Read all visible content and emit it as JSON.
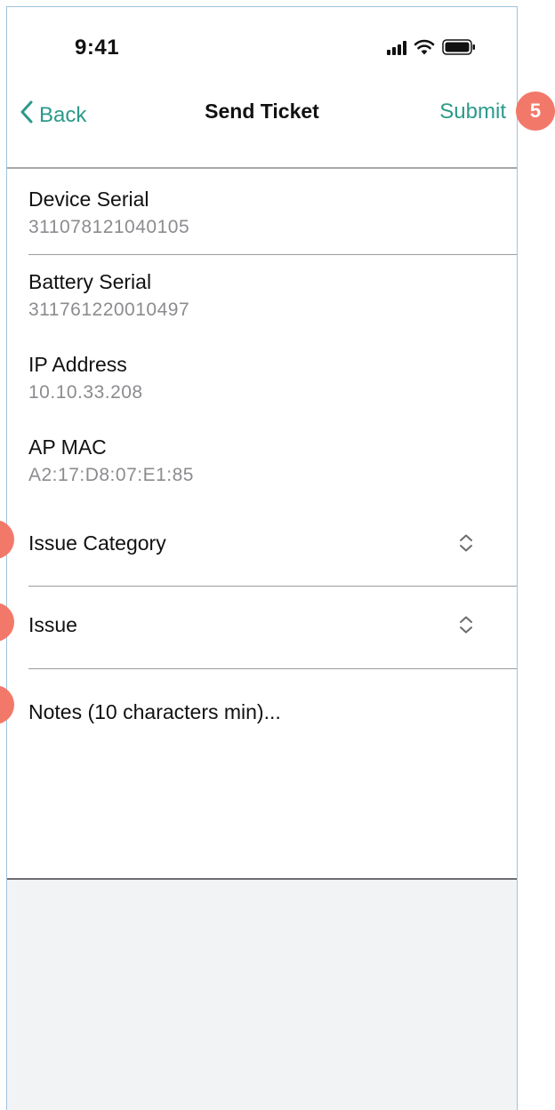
{
  "status_bar": {
    "time": "9:41"
  },
  "navbar": {
    "back_label": "Back",
    "title": "Send Ticket",
    "submit_label": "Submit"
  },
  "fields": [
    {
      "label": "Device Serial",
      "value": "311078121040105"
    },
    {
      "label": "Battery Serial",
      "value": "311761220010497"
    },
    {
      "label": "IP Address",
      "value": "10.10.33.208"
    },
    {
      "label": "AP MAC",
      "value": "A2:17:D8:07:E1:85"
    }
  ],
  "selects": [
    {
      "label": "Issue Category"
    },
    {
      "label": "Issue"
    }
  ],
  "notes": {
    "placeholder": "Notes (10 characters min)..."
  },
  "annotations": {
    "submit_badge": "5"
  },
  "colors": {
    "accent": "#2b9a8b",
    "badge": "#f2796a",
    "muted_text": "#8c8c90",
    "bottom_bg": "#f2f3f5"
  }
}
